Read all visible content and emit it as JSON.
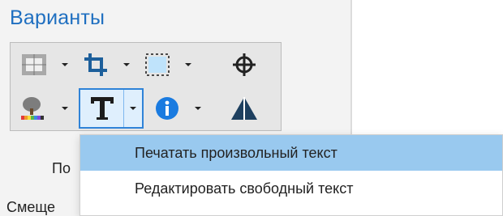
{
  "panel": {
    "title": "Варианты"
  },
  "underlying_labels": {
    "left_label_partial": "По",
    "bottom_label_partial": "Смеще"
  },
  "toolbar": {
    "row1": [
      {
        "icon": "layer-grid-icon",
        "has_dropdown": true
      },
      {
        "icon": "crop-icon",
        "has_dropdown": true
      },
      {
        "icon": "selection-frame-icon",
        "has_dropdown": true
      },
      {
        "icon": "crosshair-icon",
        "has_dropdown": false
      }
    ],
    "row2": [
      {
        "icon": "color-tree-icon",
        "has_dropdown": true
      },
      {
        "icon": "text-icon",
        "has_dropdown": true,
        "active": true
      },
      {
        "icon": "info-icon",
        "has_dropdown": true
      },
      {
        "icon": "triangle-icon",
        "has_dropdown": false
      }
    ]
  },
  "menu": {
    "items": [
      {
        "label": "Печатать произвольный текст",
        "selected": true
      },
      {
        "label": "Редактировать свободный текст",
        "selected": false
      }
    ]
  },
  "colors": {
    "title": "#1f6fc0",
    "menu_highlight": "#99c9ef",
    "active_border": "#2f83d8",
    "info_icon": "#1a7be0",
    "crop_icon": "#1d5f9b",
    "triangle_icon": "#1d3f5f"
  }
}
